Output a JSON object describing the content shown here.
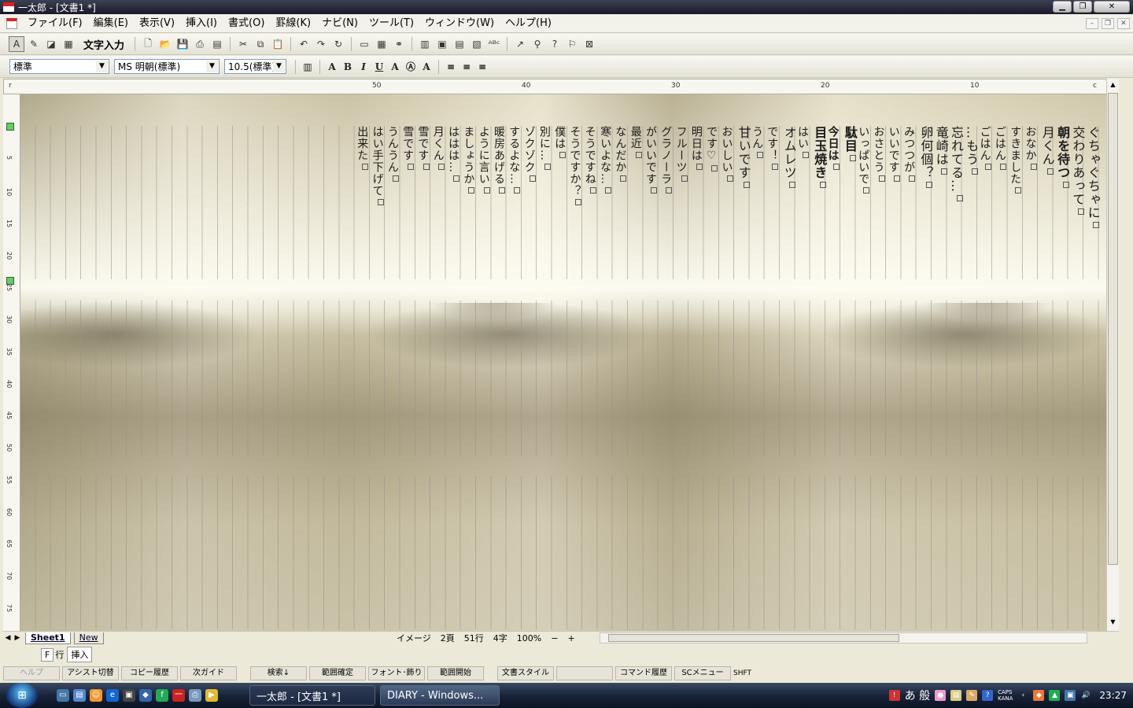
{
  "window": {
    "title": "一太郎 - [文書1 *]"
  },
  "menu": [
    "ファイル(F)",
    "編集(E)",
    "表示(V)",
    "挿入(I)",
    "書式(O)",
    "罫線(K)",
    "ナビ(N)",
    "ツール(T)",
    "ウィンドウ(W)",
    "ヘルプ(H)"
  ],
  "toolbar": {
    "mode_label": "文字入力"
  },
  "format": {
    "style": "標準",
    "font": "MS 明朝(標準)",
    "size": "10.5(標準)"
  },
  "ruler": {
    "top": [
      "50",
      "40",
      "30",
      "20",
      "10"
    ],
    "left": [
      "5",
      "10",
      "15",
      "20",
      "25",
      "30",
      "35",
      "40",
      "45",
      "50",
      "55",
      "60",
      "65",
      "70",
      "75"
    ],
    "corner": "r",
    "right_corner": "c"
  },
  "document": {
    "columns": [
      "ぐちゃぐちゃに",
      "交わりあって",
      "朝を待つ",
      "月くん",
      "おなか",
      "すきました",
      "ごはん",
      "ごはん",
      "…もう",
      "忘れてる…",
      "竜崎は",
      "卵何個？",
      "みつつが",
      "いいです",
      "おさとう",
      "いっぱいで",
      "駄目",
      "今日は",
      "目玉焼き",
      "はい",
      "オムレツ",
      "です！",
      "うん",
      "甘いです",
      "おいしい",
      "です♡",
      "明日は",
      "フルーツ",
      "グラノーラ",
      "がいいです",
      "最近",
      "なんだか",
      "寒いよな…",
      "そうですね",
      "そうですか？",
      "僕は",
      "別に…",
      "ゾクゾク",
      "するよな…",
      "暖房あげる",
      "ように言い",
      "ましょうか",
      "ははは…",
      "月くん",
      "雪です",
      "雪です",
      "うんうん",
      "はい手下げて",
      "出来た"
    ]
  },
  "sheet": {
    "tab1": "Sheet1",
    "tab2": "New"
  },
  "status": {
    "view": "イメージ",
    "page": "2頁",
    "line": "51行",
    "char": "4字",
    "zoom": "100%"
  },
  "status2": {
    "f": "F",
    "row": "行",
    "mode": "挿入"
  },
  "fkeys": [
    "ヘルプ",
    "アシスト切替",
    "コピー履歴",
    "次ガイド",
    "検索↓",
    "範囲確定",
    "フォント･飾り",
    "範囲開始",
    "文書スタイル",
    "",
    "コマンド履歴",
    "SCメニュー"
  ],
  "fkeys_shift": "SHFT",
  "taskbar": {
    "tasks": [
      "一太郎 - [文書1 *]",
      "DIARY - Windows..."
    ],
    "ime": "あ 般",
    "caps": "CAPS",
    "kana": "KANA",
    "clock": "23:27"
  }
}
